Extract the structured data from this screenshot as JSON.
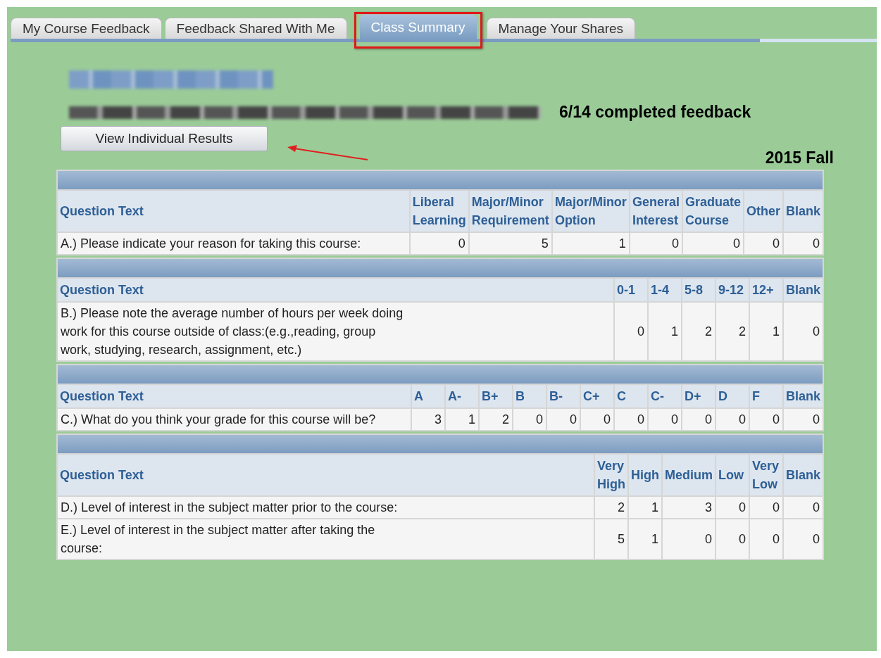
{
  "tabs": [
    {
      "label": "My Course Feedback",
      "selected": false,
      "highlighted": false
    },
    {
      "label": "Feedback Shared With Me",
      "selected": false,
      "highlighted": false
    },
    {
      "label": "Class Summary",
      "selected": true,
      "highlighted": true
    },
    {
      "label": "Manage Your Shares",
      "selected": false,
      "highlighted": false
    }
  ],
  "header": {
    "redacted": [
      {
        "kind": "name"
      },
      {
        "kind": "course"
      }
    ],
    "completed": "6/14 completed feedback",
    "term": "2015 Fall"
  },
  "view_button": {
    "label": "View Individual Results",
    "annotated": true
  },
  "tables": [
    {
      "columns": [
        "Question Text",
        "Liberal Learning",
        "Major/Minor Requirement",
        "Major/Minor Option",
        "General Interest",
        "Graduate Course",
        "Other",
        "Blank"
      ],
      "rows": [
        {
          "question": "A.) Please indicate your reason for taking this course:",
          "counts": [
            "0",
            "5",
            "1",
            "0",
            "0",
            "0",
            "0"
          ]
        }
      ]
    },
    {
      "columns": [
        "Question Text",
        "0-1",
        "1-4",
        "5-8",
        "9-12",
        "12+",
        "Blank"
      ],
      "rows": [
        {
          "question": "B.) Please note the average number of hours per week doing work for this course outside of class:(e.g.,reading, group work, studying, research, assignment, etc.)",
          "counts": [
            "0",
            "1",
            "2",
            "2",
            "1",
            "0"
          ]
        }
      ]
    },
    {
      "columns": [
        "Question Text",
        "A",
        "A-",
        "B+",
        "B",
        "B-",
        "C+",
        "C",
        "C-",
        "D+",
        "D",
        "F",
        "Blank"
      ],
      "rows": [
        {
          "question": "C.) What do you think your grade for this course will be?",
          "counts": [
            "3",
            "1",
            "2",
            "0",
            "0",
            "0",
            "0",
            "0",
            "0",
            "0",
            "0",
            "0"
          ]
        }
      ]
    },
    {
      "columns": [
        "Question Text",
        "Very High",
        "High",
        "Medium",
        "Low",
        "Very Low",
        "Blank"
      ],
      "rows": [
        {
          "question": "D.) Level of interest in the subject matter prior to the course:",
          "counts": [
            "2",
            "1",
            "3",
            "0",
            "0",
            "0"
          ]
        },
        {
          "question": "E.) Level of interest in the subject matter after taking the course:",
          "counts": [
            "5",
            "1",
            "0",
            "0",
            "0",
            "0"
          ]
        }
      ]
    }
  ]
}
